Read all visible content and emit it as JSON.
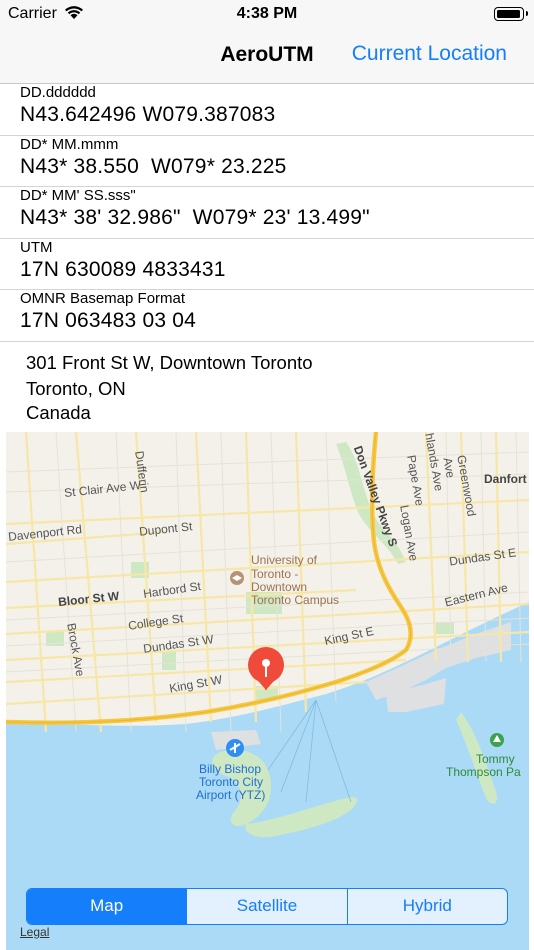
{
  "status_bar": {
    "carrier": "Carrier",
    "time": "4:38 PM",
    "battery_level": 1.0
  },
  "nav": {
    "title": "AeroUTM",
    "right_button": "Current Location"
  },
  "rows": [
    {
      "label": "DD.dddddd",
      "value": "N43.642496 W079.387083"
    },
    {
      "label": "DD* MM.mmm",
      "value": "N43* 38.550  W079* 23.225"
    },
    {
      "label": "DD* MM' SS.sss\"",
      "value": "N43* 38' 32.986\"  W079* 23' 13.499\""
    },
    {
      "label": "UTM",
      "value": "17N 630089 4833431"
    },
    {
      "label": "OMNR Basemap Format",
      "value": "17N 063483 03 04"
    }
  ],
  "address": {
    "line1": "301 Front St W,  Downtown Toronto",
    "line2": "Toronto, ON",
    "line3": "Canada"
  },
  "map": {
    "labels": {
      "dufferin": "Dufferin",
      "st_clair": "St Clair Ave W",
      "davenport": "Davenport Rd",
      "dupont": "Dupont St",
      "university": "University of",
      "university2": "Toronto -",
      "university3": "Downtown",
      "university4": "Toronto Campus",
      "harbord": "Harbord St",
      "bloor": "Bloor St W",
      "college": "College St",
      "dundas_w": "Dundas St W",
      "brock": "Brock Ave",
      "king_w": "King St W",
      "king_e": "King St E",
      "dundas_e": "Dundas St E",
      "eastern": "Eastern Ave",
      "don_valley": "Don Valley Pkwy S",
      "pape": "Pape Ave",
      "logan": "Logan Ave",
      "greenwood": "Greenwood Ave",
      "danforth": "Danfort",
      "highlands": "hlands Ave",
      "airport1": "Billy Bishop",
      "airport2": "Toronto City",
      "airport3": "Airport (YTZ)",
      "tommy1": "Tommy",
      "tommy2": "Thompson Pa"
    },
    "map_types": [
      "Map",
      "Satellite",
      "Hybrid"
    ],
    "selected_map_type": "Map",
    "legal": "Legal"
  }
}
